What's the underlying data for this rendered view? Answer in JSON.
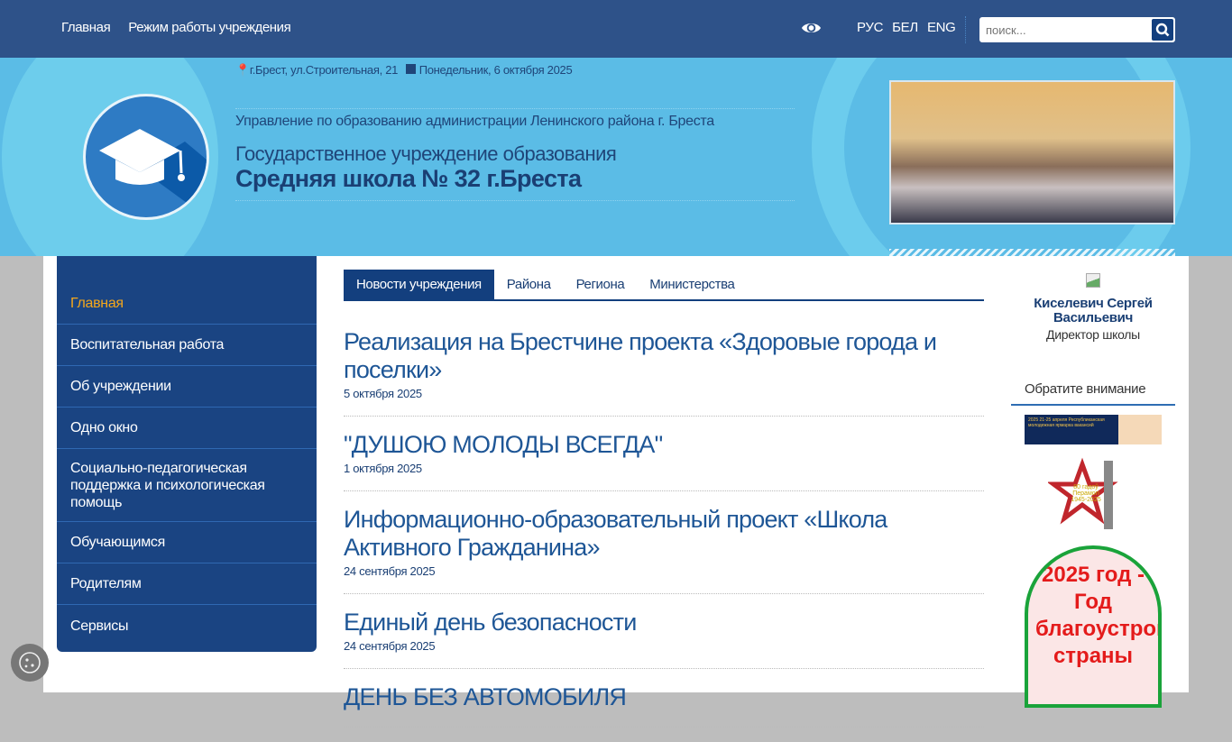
{
  "topnav": {
    "items": [
      "Главная",
      "Режим работы учреждения"
    ]
  },
  "accessibility_icon": "eye-icon",
  "languages": [
    "РУС",
    "БЕЛ",
    "ENG"
  ],
  "search": {
    "placeholder": "поиск...",
    "value": "",
    "icon": "search-icon"
  },
  "header": {
    "address": "г.Брест, ул.Строительная, 21",
    "date": "Понедельник, 6 октября 2025",
    "org_parent": "Управление по образованию администрации Ленинского района г. Бреста",
    "org_type": "Государственное учреждение образования",
    "org_name": "Средняя школа № 32 г.Бреста"
  },
  "sidebar": {
    "items": [
      {
        "label": "Главная",
        "active": true
      },
      {
        "label": "Воспитательная работа"
      },
      {
        "label": "Об учреждении"
      },
      {
        "label": "Одно окно"
      },
      {
        "label": "Социально-педагогическая поддержка и психологическая помощь"
      },
      {
        "label": "Обучающимся"
      },
      {
        "label": "Родителям"
      },
      {
        "label": "Сервисы"
      }
    ]
  },
  "tabs": [
    "Новости учреждения",
    "Района",
    "Региона",
    "Министерства"
  ],
  "news": [
    {
      "title": "Реализация на Брестчине проекта «Здоровые города и поселки»",
      "date": "5 октября 2025"
    },
    {
      "title": "\"ДУШОЮ МОЛОДЫ ВСЕГДА\"",
      "date": "1 октября 2025"
    },
    {
      "title": "Информационно-образовательный проект «Школа Активного Гражданина»",
      "date": "24 сентября 2025"
    },
    {
      "title": "Единый день безопасности",
      "date": "24 сентября 2025"
    },
    {
      "title": "ДЕНЬ БЕЗ АВТОМОБИЛЯ",
      "date": ""
    }
  ],
  "director": {
    "name": "Киселевич Сергей Васильевич",
    "role": "Директор школы"
  },
  "attention": {
    "title": "Обратите внимание",
    "banners": [
      {
        "text": "2025 21-25 апреля Республиканская молодежная ярмарка вакансий"
      },
      {
        "text": "80 гадоў Перамогі 1945-2025"
      },
      {
        "text": "2025 год - Год благоустройства страны"
      }
    ]
  },
  "colors": {
    "topbar": "#2e5289",
    "header": "#5bbce6",
    "sidebar": "#1a4482",
    "active": "#f4a71b",
    "link": "#1e5696"
  }
}
